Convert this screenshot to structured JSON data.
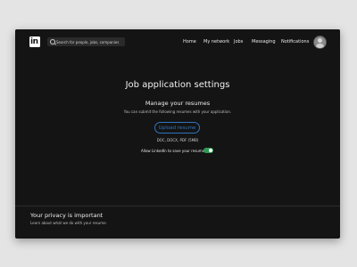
{
  "nav": {
    "logo_text": "in",
    "search_placeholder": "Search for people, jobs, companies",
    "links": [
      "Home",
      "My network",
      "Jobs",
      "Messaging",
      "Notifications"
    ]
  },
  "main": {
    "title": "Job application settings",
    "section_title": "Manage your resumes",
    "section_desc": "You can submit the following resumes with your application.",
    "upload_label": "Upload resume",
    "formats": "DOC, DOCX, PDF (5MB)",
    "allow_label": "Allow LinkedIn to save your resumes",
    "allow_enabled": true
  },
  "footer": {
    "title": "Your privacy is important",
    "desc": "Learn about what we do with your resume."
  },
  "colors": {
    "background": "#141414",
    "accent": "#2f74c0",
    "toggle_on": "#2f9a54"
  }
}
